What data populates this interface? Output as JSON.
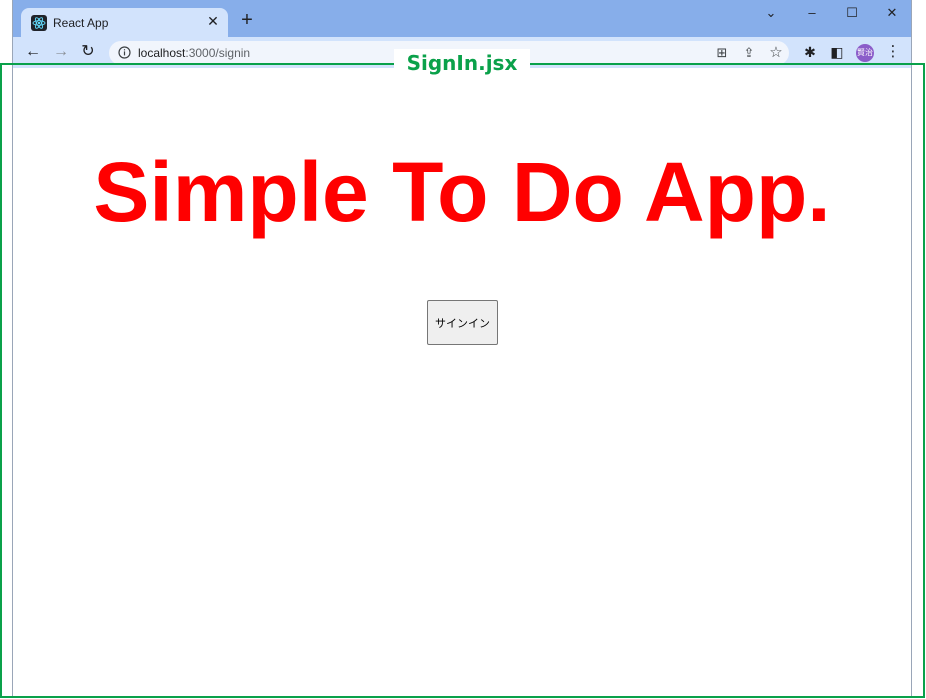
{
  "browser": {
    "tab": {
      "title": "React App",
      "close_glyph": "✕",
      "favicon": "react-icon"
    },
    "new_tab_glyph": "+",
    "window_controls": {
      "dropdown": "⌄",
      "minimize": "–",
      "maximize": "☐",
      "close": "✕"
    },
    "toolbar": {
      "back": "←",
      "forward": "→",
      "reload": "↻",
      "url_host": "localhost",
      "url_path": ":3000/signin",
      "translate": "⊞",
      "share": "⇪",
      "bookmark": "☆",
      "extensions": "✱",
      "sidepanel": "◧",
      "profile": "賢治",
      "menu": "⋮"
    }
  },
  "page": {
    "title": "Simple To Do App.",
    "signin_button_label": "サインイン"
  },
  "annotation": {
    "label": "SignIn.jsx",
    "color": "#0aa14a"
  },
  "colors": {
    "title": "#ff0000",
    "tabstrip": "#87aeea",
    "toolbar": "#d2e3fc"
  }
}
